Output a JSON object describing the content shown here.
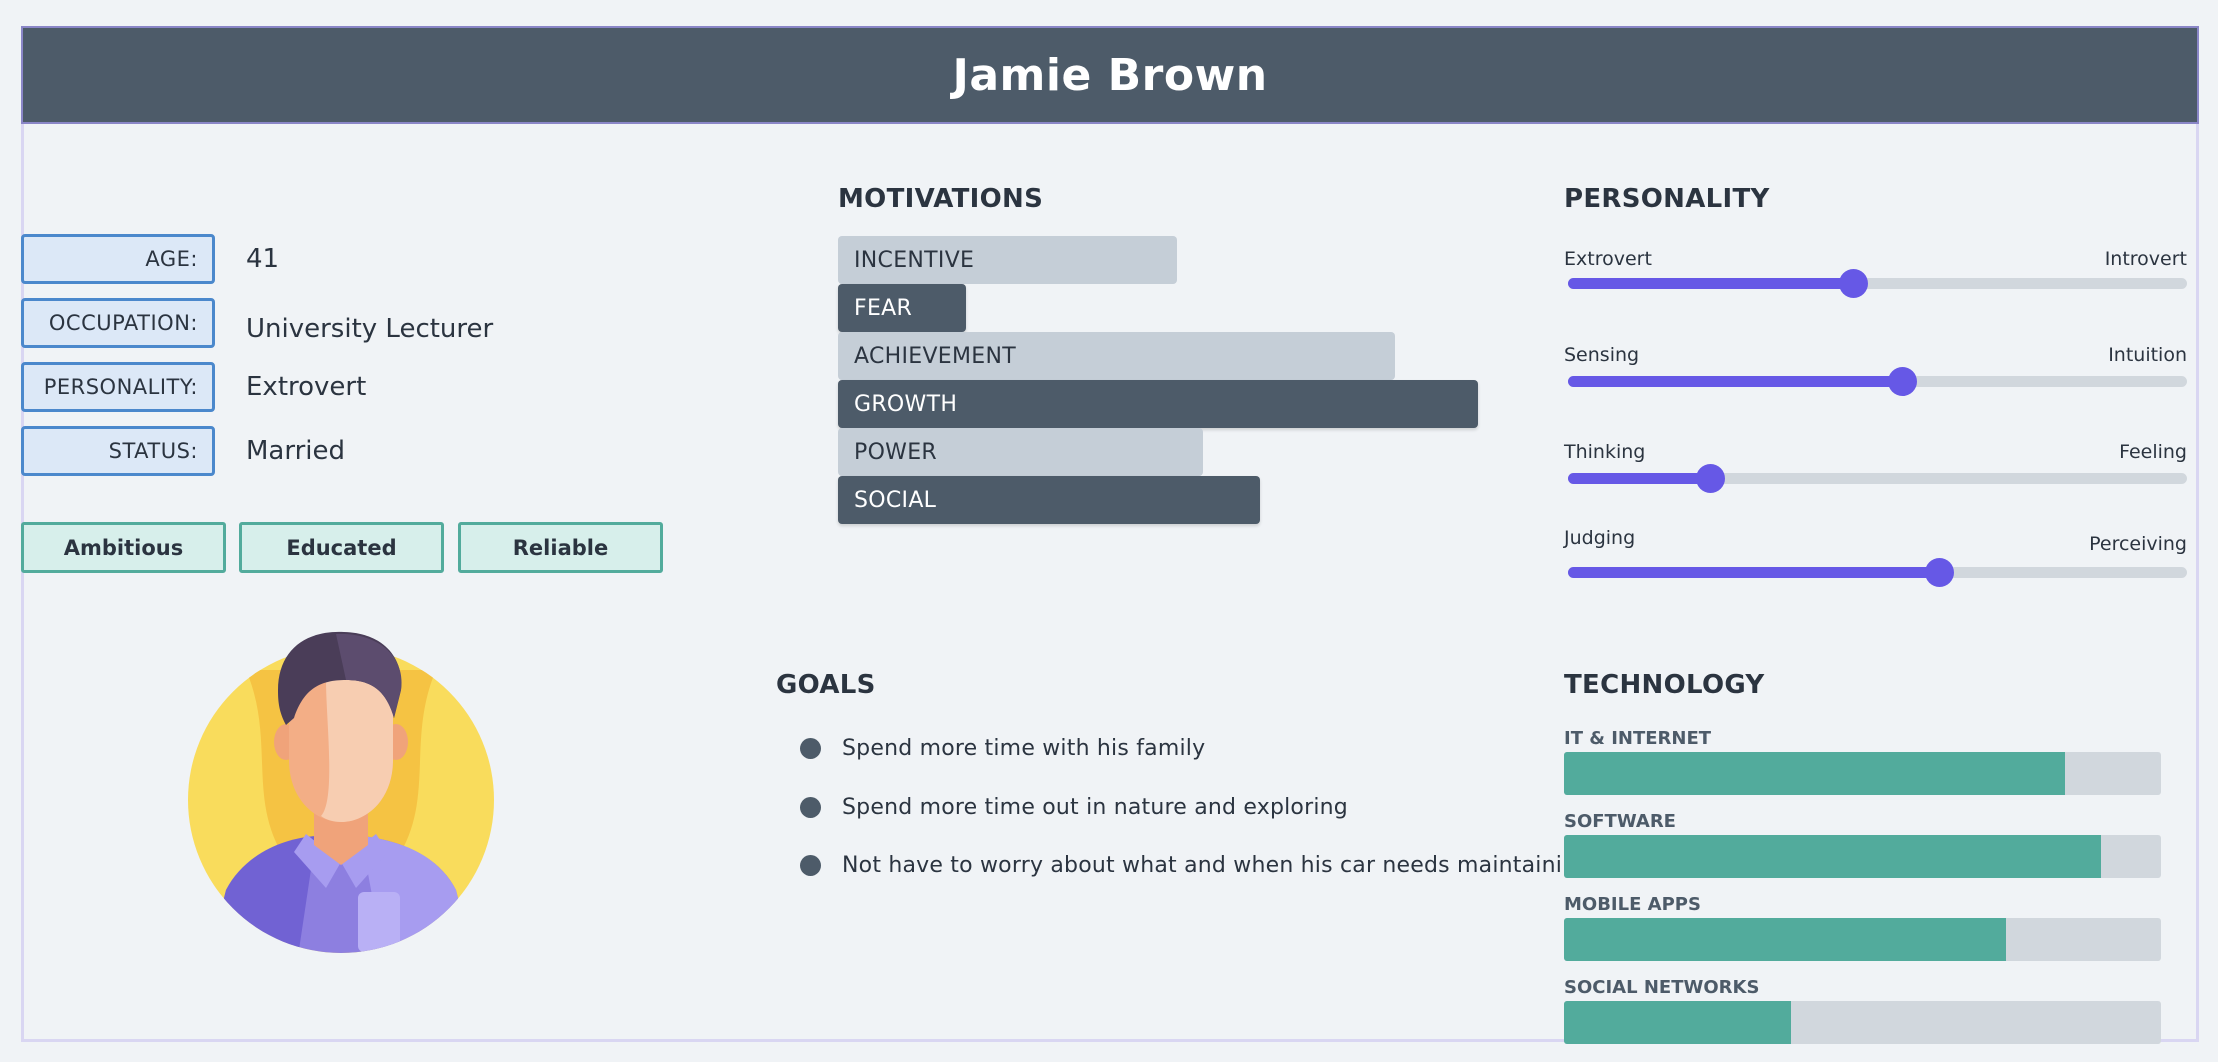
{
  "header": {
    "name": "Jamie Brown"
  },
  "info": [
    {
      "label": "AGE:",
      "value": "41"
    },
    {
      "label": "OCCUPATION:",
      "value": "University Lecturer"
    },
    {
      "label": "PERSONALITY:",
      "value": "Extrovert"
    },
    {
      "label": "STATUS:",
      "value": "Married"
    }
  ],
  "tags": [
    "Ambitious",
    "Educated",
    "Reliable"
  ],
  "motivations": {
    "title": "MOTIVATIONS",
    "items": [
      {
        "label": "INCENTIVE",
        "value": 0.53,
        "style": "light"
      },
      {
        "label": "FEAR",
        "value": 0.2,
        "style": "dark"
      },
      {
        "label": "ACHIEVEMENT",
        "value": 0.87,
        "style": "light"
      },
      {
        "label": "GROWTH",
        "value": 1.0,
        "style": "dark"
      },
      {
        "label": "POWER",
        "value": 0.57,
        "style": "light"
      },
      {
        "label": "SOCIAL",
        "value": 0.66,
        "style": "dark"
      }
    ]
  },
  "personality": {
    "title": "PERSONALITY",
    "sliders": [
      {
        "left": "Extrovert",
        "right": "Introvert",
        "value": 0.46
      },
      {
        "left": "Sensing",
        "right": "Intuition",
        "value": 0.54
      },
      {
        "left": "Thinking",
        "right": "Feeling",
        "value": 0.23
      },
      {
        "left": "Judging",
        "right": "Perceiving",
        "value": 0.6
      }
    ]
  },
  "goals": {
    "title": "GOALS",
    "items": [
      "Spend more time with his family",
      "Spend more time out in nature and exploring",
      "Not have to worry about what and when his car needs maintaining"
    ]
  },
  "technology": {
    "title": "TECHNOLOGY",
    "items": [
      {
        "label": "IT & INTERNET",
        "value": 0.84
      },
      {
        "label": "SOFTWARE",
        "value": 0.9
      },
      {
        "label": "MOBILE APPS",
        "value": 0.74
      },
      {
        "label": "SOCIAL NETWORKS",
        "value": 0.38
      }
    ]
  },
  "colors": {
    "header": "#4d5b69",
    "accent_purple": "#6658e6",
    "accent_teal": "#52ab9c",
    "label_blue": "#4b88cc"
  },
  "avatar": {
    "icon": "person-avatar-icon"
  }
}
